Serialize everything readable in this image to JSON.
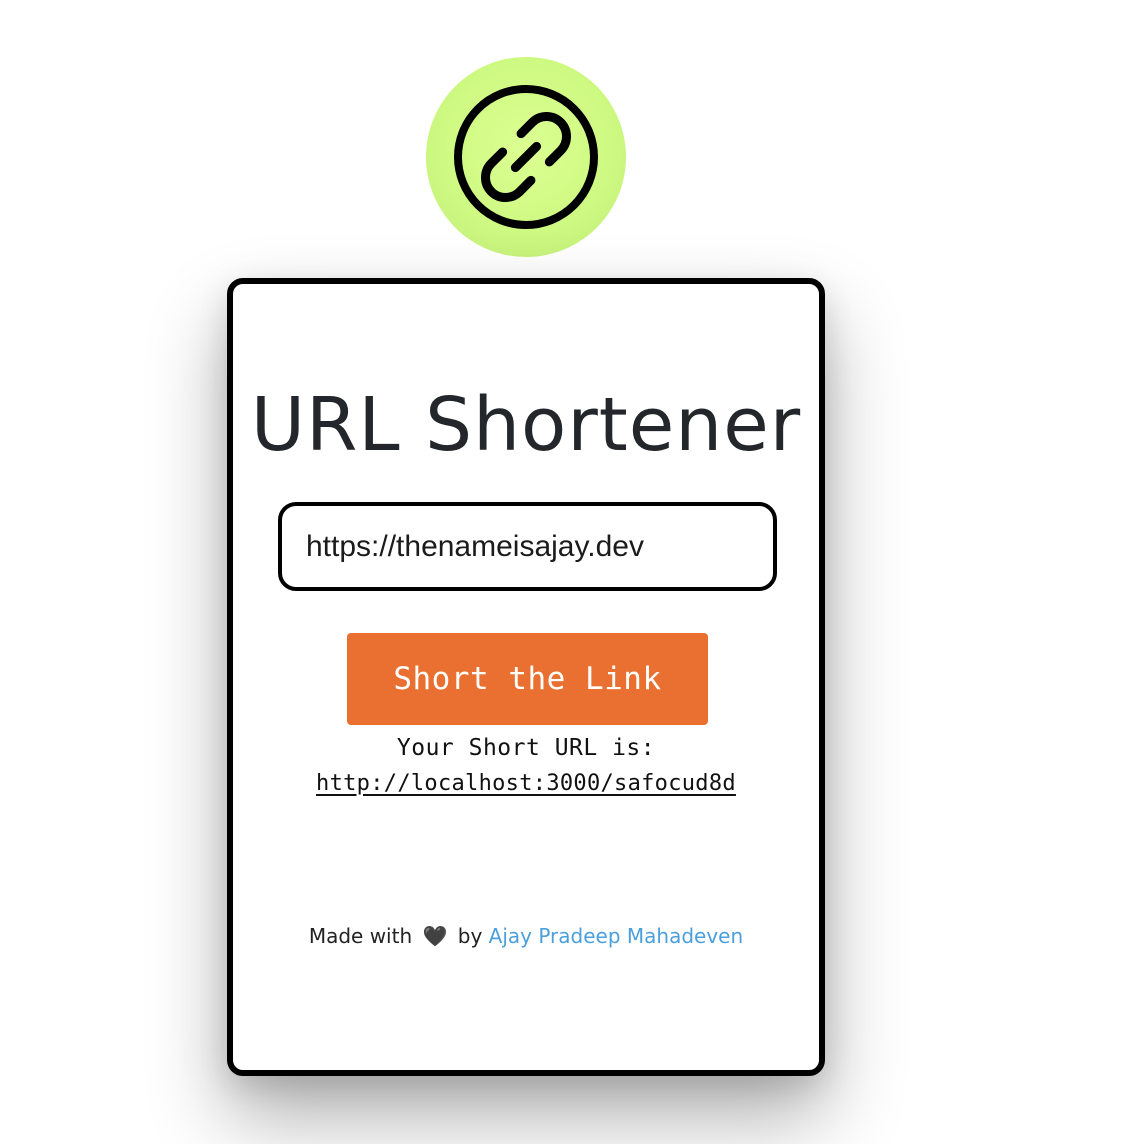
{
  "logo": {
    "icon": "link-icon",
    "badge_color": "#cdf981"
  },
  "card": {
    "title": "URL Shortener",
    "input": {
      "value": "https://thenameisajay.dev",
      "placeholder": ""
    },
    "button_label": "Short the Link",
    "button_color": "#e97030",
    "result_label": "Your Short URL is:",
    "result_url": "http://localhost:3000/safocud8d"
  },
  "footer": {
    "prefix": "Made with",
    "heart": "🖤",
    "by": "by",
    "author": "Ajay Pradeep Mahadeven",
    "author_color": "#4a9fdc"
  }
}
